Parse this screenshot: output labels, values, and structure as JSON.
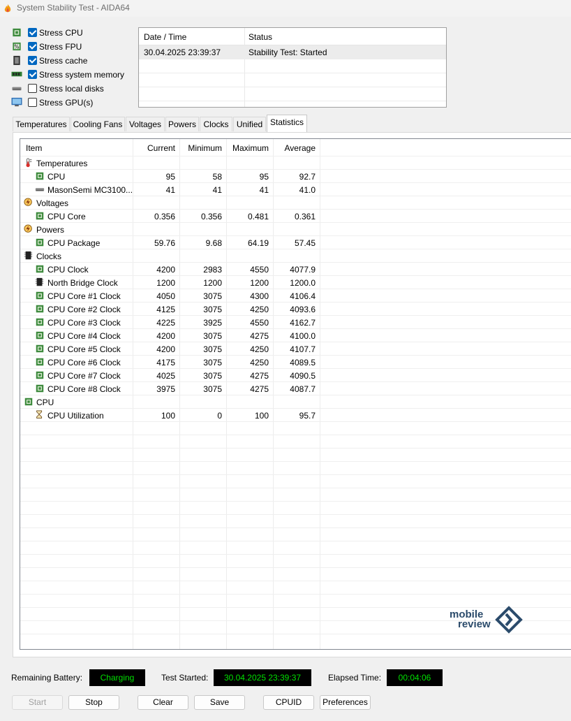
{
  "window": {
    "title": "System Stability Test - AIDA64"
  },
  "stress_options": [
    {
      "label": "Stress CPU",
      "checked": true,
      "icon": "cpu-chip-icon"
    },
    {
      "label": "Stress FPU",
      "checked": true,
      "icon": "fpu-chip-icon"
    },
    {
      "label": "Stress cache",
      "checked": true,
      "icon": "cache-chip-icon"
    },
    {
      "label": "Stress system memory",
      "checked": true,
      "icon": "memory-module-icon"
    },
    {
      "label": "Stress local disks",
      "checked": false,
      "icon": "disk-drive-icon"
    },
    {
      "label": "Stress GPU(s)",
      "checked": false,
      "icon": "monitor-icon"
    }
  ],
  "log": {
    "headers": {
      "datetime": "Date / Time",
      "status": "Status"
    },
    "rows": [
      {
        "datetime": "30.04.2025 23:39:37",
        "status": "Stability Test: Started"
      }
    ]
  },
  "tabs": [
    "Temperatures",
    "Cooling Fans",
    "Voltages",
    "Powers",
    "Clocks",
    "Unified",
    "Statistics"
  ],
  "active_tab": "Statistics",
  "stats": {
    "headers": {
      "item": "Item",
      "current": "Current",
      "minimum": "Minimum",
      "maximum": "Maximum",
      "average": "Average"
    },
    "rows": [
      {
        "type": "group",
        "icon": "thermometer-icon",
        "item": "Temperatures"
      },
      {
        "type": "item",
        "icon": "cpu-chip-icon",
        "item": "CPU",
        "current": "95",
        "minimum": "58",
        "maximum": "95",
        "average": "92.7"
      },
      {
        "type": "item",
        "icon": "disk-drive-icon",
        "item": "MasonSemi MC3100...",
        "current": "41",
        "minimum": "41",
        "maximum": "41",
        "average": "41.0"
      },
      {
        "type": "group",
        "icon": "voltage-icon",
        "item": "Voltages"
      },
      {
        "type": "item",
        "icon": "cpu-chip-icon",
        "item": "CPU Core",
        "current": "0.356",
        "minimum": "0.356",
        "maximum": "0.481",
        "average": "0.361"
      },
      {
        "type": "group",
        "icon": "power-icon",
        "item": "Powers"
      },
      {
        "type": "item",
        "icon": "cpu-chip-icon",
        "item": "CPU Package",
        "current": "59.76",
        "minimum": "9.68",
        "maximum": "64.19",
        "average": "57.45"
      },
      {
        "type": "group",
        "icon": "clock-chip-icon",
        "item": "Clocks"
      },
      {
        "type": "item",
        "icon": "cpu-chip-icon",
        "item": "CPU Clock",
        "current": "4200",
        "minimum": "2983",
        "maximum": "4550",
        "average": "4077.9"
      },
      {
        "type": "item",
        "icon": "northbridge-chip-icon",
        "item": "North Bridge Clock",
        "current": "1200",
        "minimum": "1200",
        "maximum": "1200",
        "average": "1200.0"
      },
      {
        "type": "item",
        "icon": "cpu-chip-icon",
        "item": "CPU Core #1 Clock",
        "current": "4050",
        "minimum": "3075",
        "maximum": "4300",
        "average": "4106.4"
      },
      {
        "type": "item",
        "icon": "cpu-chip-icon",
        "item": "CPU Core #2 Clock",
        "current": "4125",
        "minimum": "3075",
        "maximum": "4250",
        "average": "4093.6"
      },
      {
        "type": "item",
        "icon": "cpu-chip-icon",
        "item": "CPU Core #3 Clock",
        "current": "4225",
        "minimum": "3925",
        "maximum": "4550",
        "average": "4162.7"
      },
      {
        "type": "item",
        "icon": "cpu-chip-icon",
        "item": "CPU Core #4 Clock",
        "current": "4200",
        "minimum": "3075",
        "maximum": "4275",
        "average": "4100.0"
      },
      {
        "type": "item",
        "icon": "cpu-chip-icon",
        "item": "CPU Core #5 Clock",
        "current": "4200",
        "minimum": "3075",
        "maximum": "4250",
        "average": "4107.7"
      },
      {
        "type": "item",
        "icon": "cpu-chip-icon",
        "item": "CPU Core #6 Clock",
        "current": "4175",
        "minimum": "3075",
        "maximum": "4250",
        "average": "4089.5"
      },
      {
        "type": "item",
        "icon": "cpu-chip-icon",
        "item": "CPU Core #7 Clock",
        "current": "4025",
        "minimum": "3075",
        "maximum": "4275",
        "average": "4090.5"
      },
      {
        "type": "item",
        "icon": "cpu-chip-icon",
        "item": "CPU Core #8 Clock",
        "current": "3975",
        "minimum": "3075",
        "maximum": "4275",
        "average": "4087.7"
      },
      {
        "type": "group",
        "icon": "cpu-chip-icon",
        "item": "CPU"
      },
      {
        "type": "item",
        "icon": "hourglass-icon",
        "item": "CPU Utilization",
        "current": "100",
        "minimum": "0",
        "maximum": "100",
        "average": "95.7"
      }
    ]
  },
  "status_bar": {
    "battery_label": "Remaining Battery:",
    "battery_value": "Charging",
    "started_label": "Test Started:",
    "started_value": "30.04.2025 23:39:37",
    "elapsed_label": "Elapsed Time:",
    "elapsed_value": "00:04:06"
  },
  "buttons": {
    "start": "Start",
    "stop": "Stop",
    "clear": "Clear",
    "save": "Save",
    "cpuid": "CPUID",
    "preferences": "Preferences"
  },
  "watermark": {
    "line1": "mobile",
    "line2": "review"
  },
  "colors": {
    "accent": "#0067c0",
    "lcd_text": "#00e000",
    "lcd_bg": "#000000",
    "chip_green": "#3d8a3d"
  }
}
